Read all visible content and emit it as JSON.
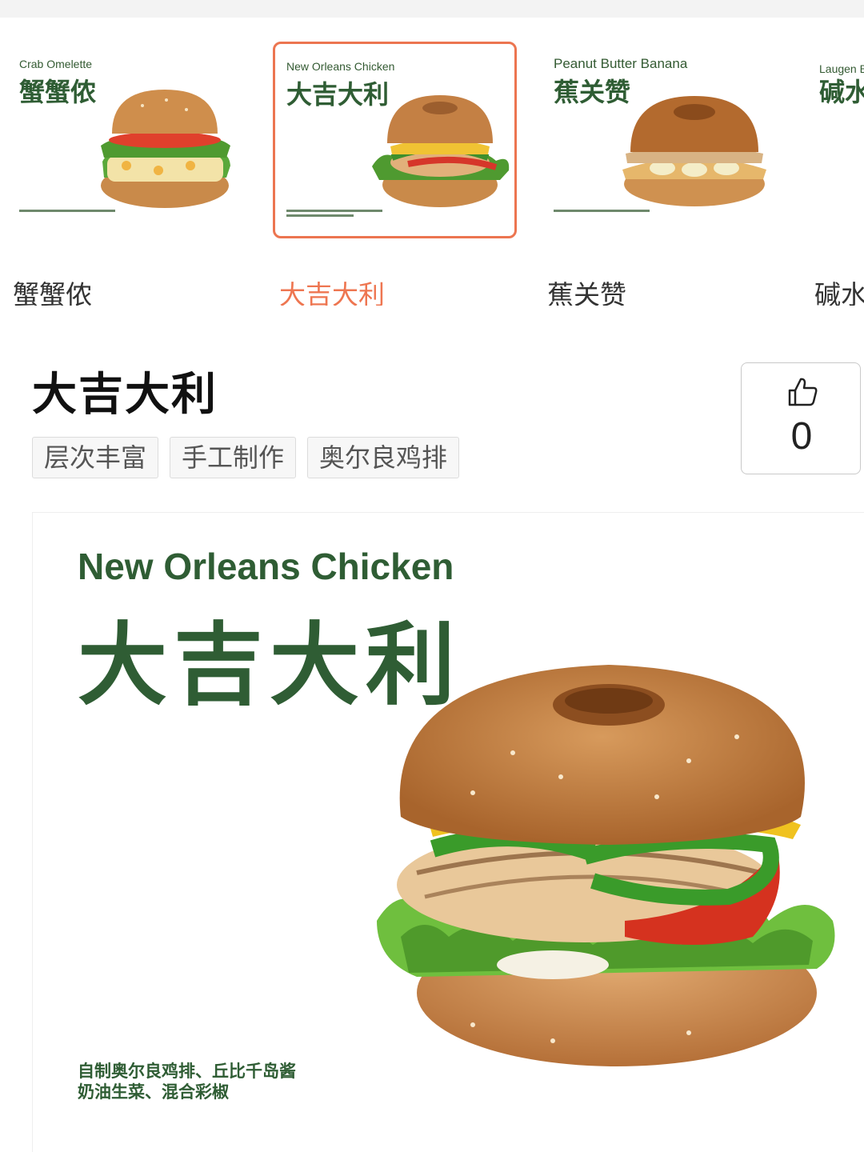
{
  "carousel": {
    "items": [
      {
        "en": "Crab Omelette",
        "cn": "蟹蟹侬",
        "label": "蟹蟹侬",
        "selected": false
      },
      {
        "en": "New Orleans Chicken",
        "cn": "大吉大利",
        "label": "大吉大利",
        "selected": true
      },
      {
        "en": "Peanut Butter Banana",
        "cn": "蕉关赞",
        "label": "蕉关赞",
        "selected": false
      },
      {
        "en": "Laugen B",
        "cn": "碱水",
        "label": "碱水",
        "selected": false
      }
    ]
  },
  "product": {
    "title": "大吉大利",
    "tags": [
      "层次丰富",
      "手工制作",
      "奥尔良鸡排"
    ],
    "likes": "0"
  },
  "hero": {
    "en": "New Orleans Chicken",
    "cn": "大吉大利",
    "ingredients_line1": "自制奥尔良鸡排、丘比千岛酱",
    "ingredients_line2": "奶油生菜、混合彩椒"
  },
  "colors": {
    "accent": "#ee7651",
    "brand_green": "#2f5d34"
  },
  "icons": {
    "like": "thumbs-up-icon"
  }
}
